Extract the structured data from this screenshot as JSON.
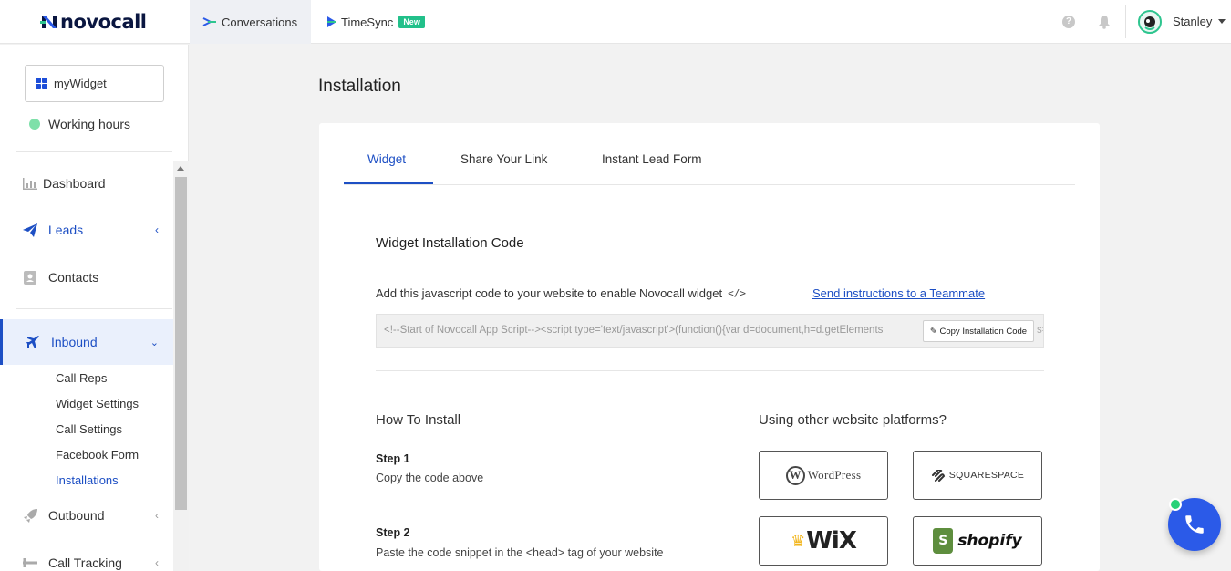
{
  "brand": {
    "name": "novocall"
  },
  "topnav": {
    "conversations": "Conversations",
    "timesync": "TimeSync",
    "timesync_badge": "New",
    "help": "?",
    "user_name": "Stanley"
  },
  "sidebar": {
    "widget_name": "myWidget",
    "working_hours": "Working hours",
    "items": {
      "dashboard": "Dashboard",
      "leads": "Leads",
      "contacts": "Contacts",
      "inbound": "Inbound",
      "outbound": "Outbound",
      "call_tracking": "Call Tracking"
    },
    "inbound_sub": [
      "Call Reps",
      "Widget Settings",
      "Call Settings",
      "Facebook Form",
      "Installations"
    ]
  },
  "page": {
    "title": "Installation",
    "tabs": [
      "Widget",
      "Share Your Link",
      "Instant Lead Form"
    ],
    "section_title": "Widget Installation Code",
    "description": "Add this javascript code to your website to enable Novocall widget",
    "code_icon": "</>",
    "send_link": "Send instructions to a Teammate",
    "code_snippet": "<!--Start of Novocall App Script--><script type='text/javascript'>(function(){var d=document,h=d.getElements",
    "code_tail": "s=",
    "copy_button": "✎ Copy Installation Code",
    "how_title": "How To Install",
    "steps": [
      {
        "heading": "Step 1",
        "text": "Copy the code above"
      },
      {
        "heading": "Step 2",
        "text": "Paste the code snippet in the <head> tag of your website"
      }
    ],
    "platforms_title": "Using other website platforms?",
    "platforms": {
      "wordpress": "WordPress",
      "squarespace": "SQUARESPACE",
      "wix": "WiX",
      "shopify": "shopify"
    }
  },
  "colors": {
    "accent": "#1d4fc4",
    "status_green": "#7ee0a9",
    "badge_green": "#22c08a",
    "fab_blue": "#2b5ae8"
  }
}
